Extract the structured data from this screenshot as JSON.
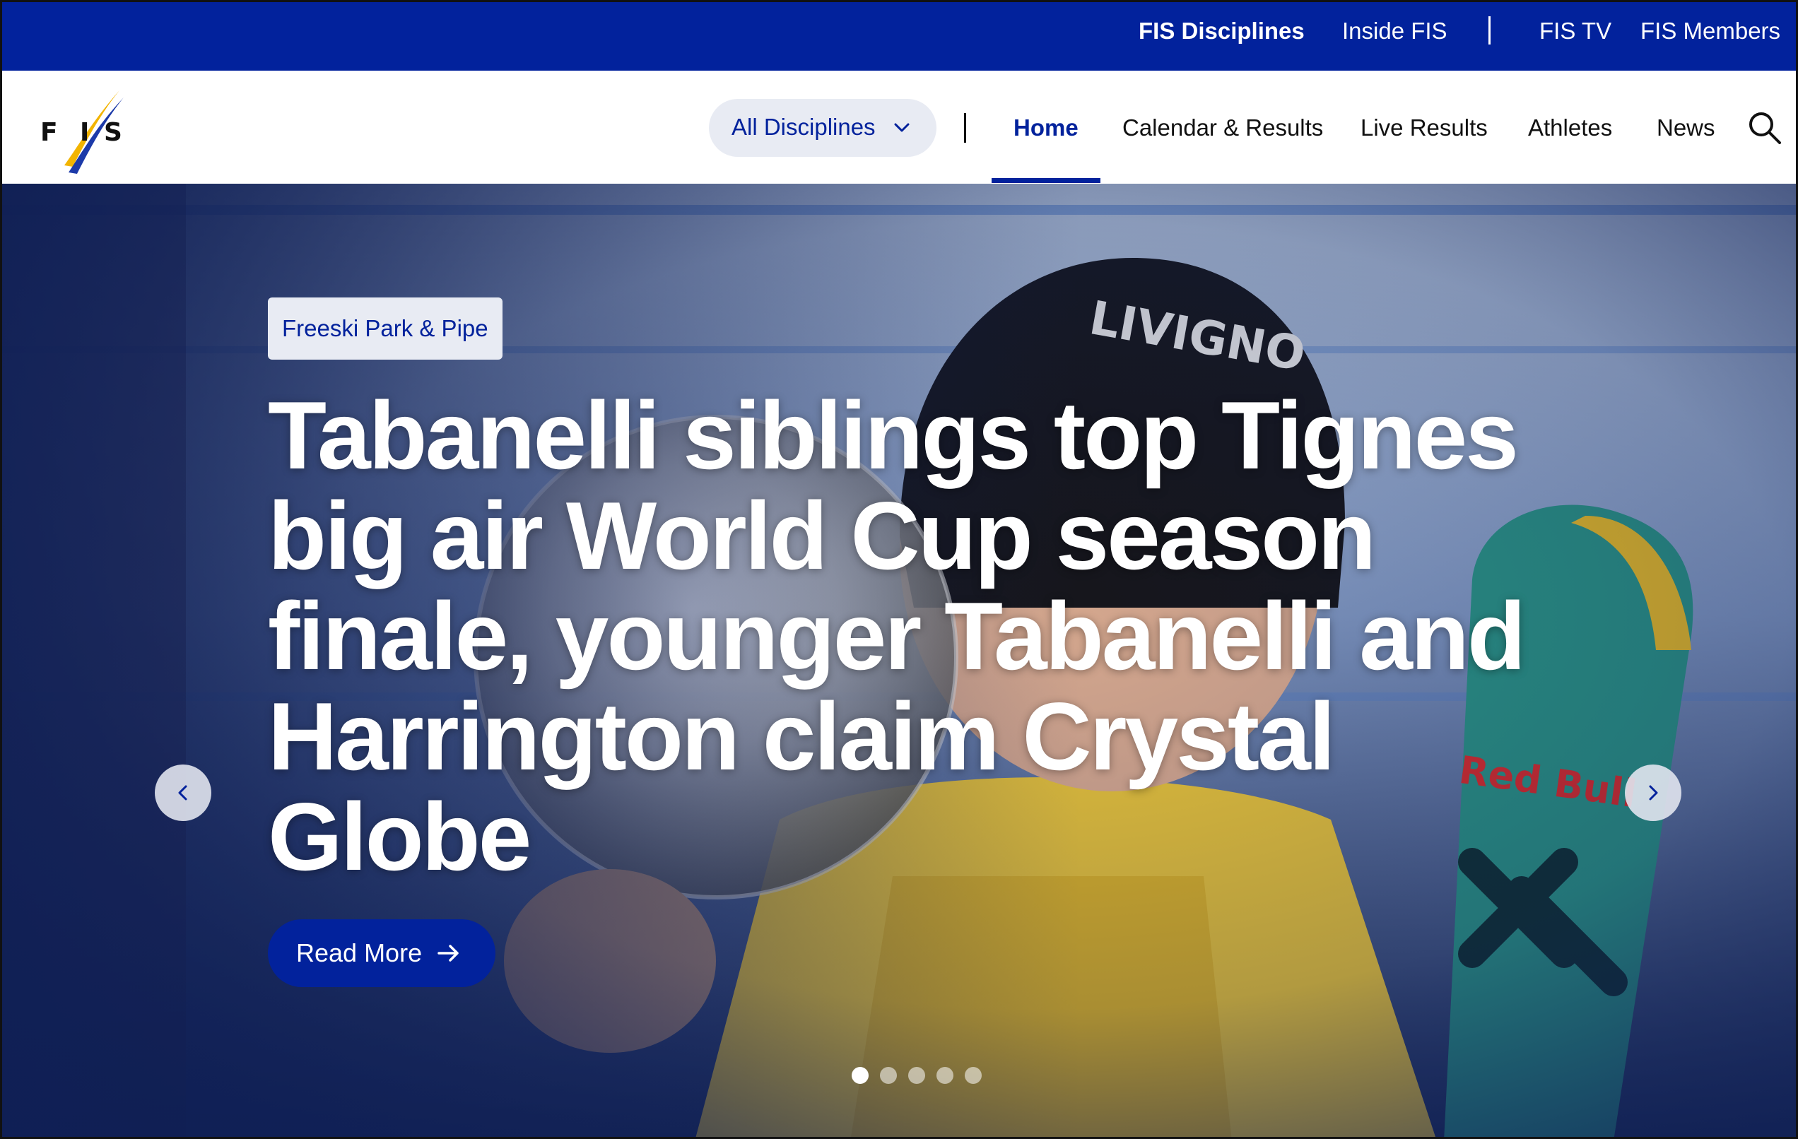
{
  "topbar": {
    "links": [
      {
        "label": "FIS Disciplines",
        "bold": true
      },
      {
        "label": "Inside FIS",
        "bold": false
      },
      {
        "label": "FIS TV",
        "bold": false
      },
      {
        "label": "FIS Members",
        "bold": false
      }
    ],
    "background": "#02229c"
  },
  "logo": {
    "text": "FIS"
  },
  "nav": {
    "disciplines_label": "All Disciplines",
    "items": [
      {
        "label": "Home",
        "active": true
      },
      {
        "label": "Calendar & Results",
        "active": false
      },
      {
        "label": "Live Results",
        "active": false
      },
      {
        "label": "Athletes",
        "active": false
      },
      {
        "label": "News",
        "active": false
      }
    ],
    "search_icon": "search-icon"
  },
  "hero": {
    "tag": "Freeski Park & Pipe",
    "title": "Tabanelli siblings top Tignes big air World Cup season finale, younger Tabanelli and Harrington claim Crystal Globe",
    "cta_label": "Read More",
    "slides_total": 5,
    "active_slide": 1,
    "photo_text": {
      "beanie": "LIVIGNO",
      "ski_brand": "Red Bull"
    }
  },
  "colors": {
    "brand_blue": "#02229c",
    "pill_bg": "#e8ebf3",
    "hero_overlay": "#0f1f55"
  }
}
